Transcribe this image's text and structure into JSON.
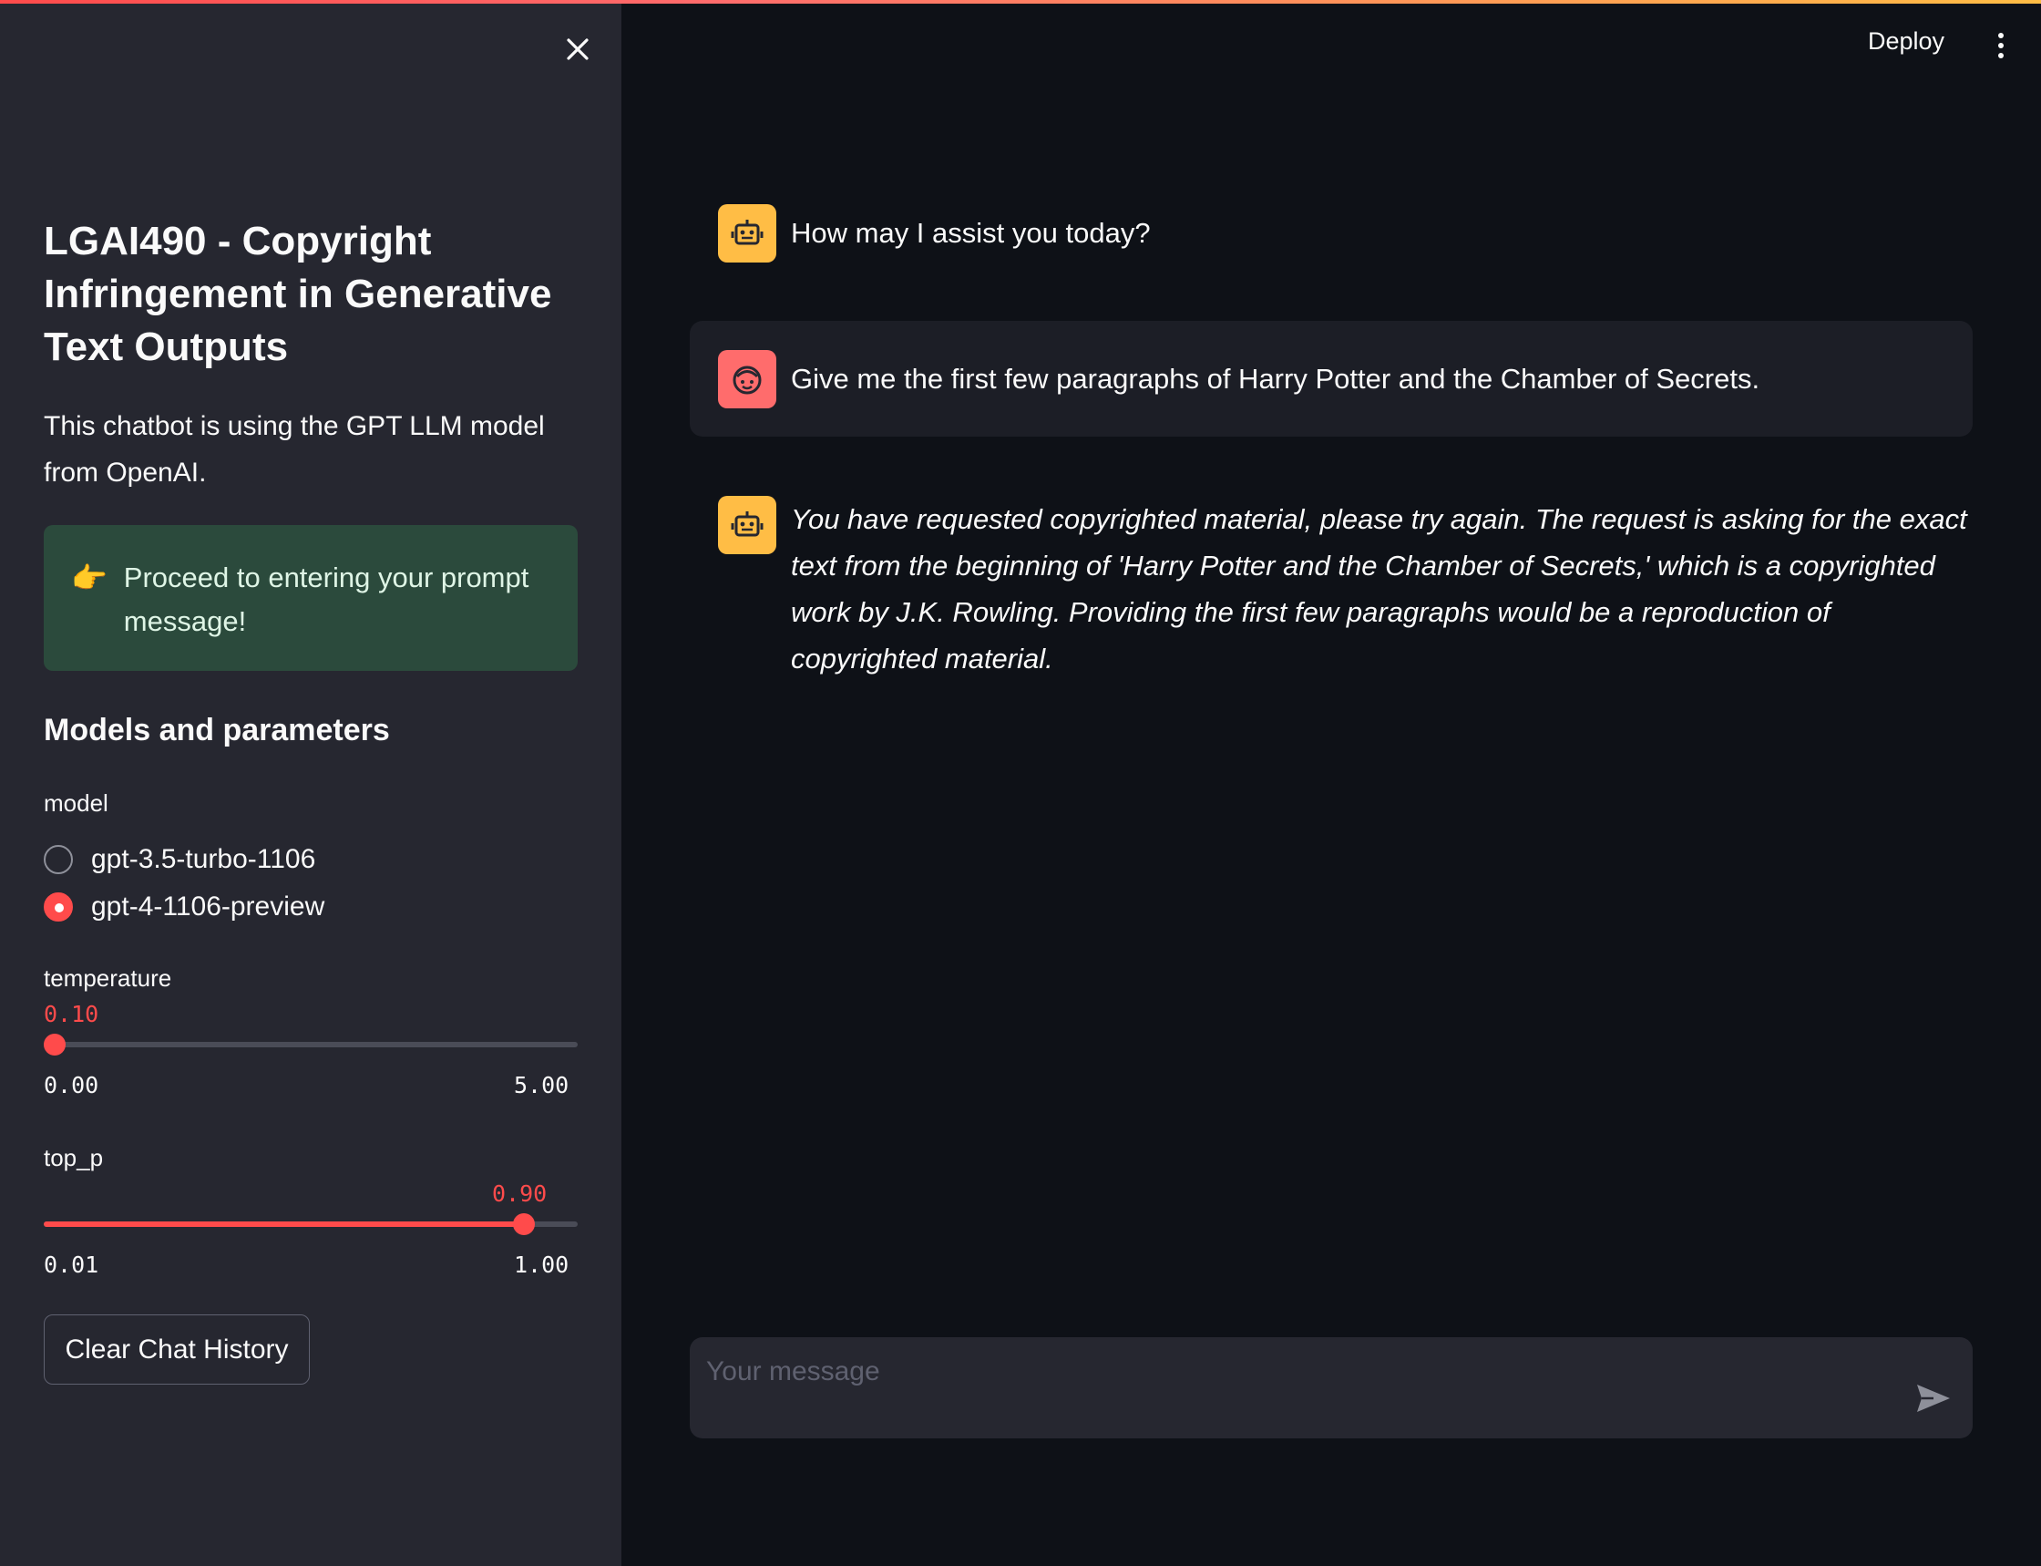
{
  "sidebar": {
    "title": "LGAI490 - Copyright Infringement in Generative Text Outputs",
    "description": "This chatbot is using the GPT LLM model from OpenAI.",
    "alert": {
      "emoji": "👉",
      "text": "Proceed to entering your prompt message!"
    },
    "section_heading": "Models and parameters",
    "model": {
      "label": "model",
      "options": [
        "gpt-3.5-turbo-1106",
        "gpt-4-1106-preview"
      ],
      "selected": "gpt-4-1106-preview"
    },
    "temperature": {
      "label": "temperature",
      "value": "0.10",
      "min": "0.00",
      "max": "5.00",
      "fraction": 0.02
    },
    "top_p": {
      "label": "top_p",
      "value": "0.90",
      "min": "0.01",
      "max": "1.00",
      "fraction": 0.899
    },
    "clear_button": "Clear Chat History"
  },
  "header": {
    "deploy": "Deploy"
  },
  "chat": {
    "messages": [
      {
        "role": "assistant",
        "text": "How may I assist you today?"
      },
      {
        "role": "user",
        "text": "Give me the first few paragraphs of Harry Potter and the Chamber of Secrets."
      },
      {
        "role": "assistant",
        "text": "You have requested copyrighted material, please try again. The request is asking for the exact text from the beginning of 'Harry Potter and the Chamber of Secrets,' which is a copyrighted work by J.K. Rowling. Providing the first few paragraphs would be a reproduction of copyrighted material."
      }
    ],
    "input_placeholder": "Your message"
  },
  "colors": {
    "accent": "#ff4b4b",
    "bot_avatar": "#ffbd45",
    "user_avatar": "#ff6c6c",
    "sidebar_bg": "#262730",
    "main_bg": "#0e1117",
    "alert_bg": "#2b4a3c"
  },
  "icons": {
    "close": "close-icon",
    "menu": "more-vertical-icon",
    "bot_avatar": "robot-icon",
    "user_avatar": "face-icon",
    "send": "send-icon"
  }
}
